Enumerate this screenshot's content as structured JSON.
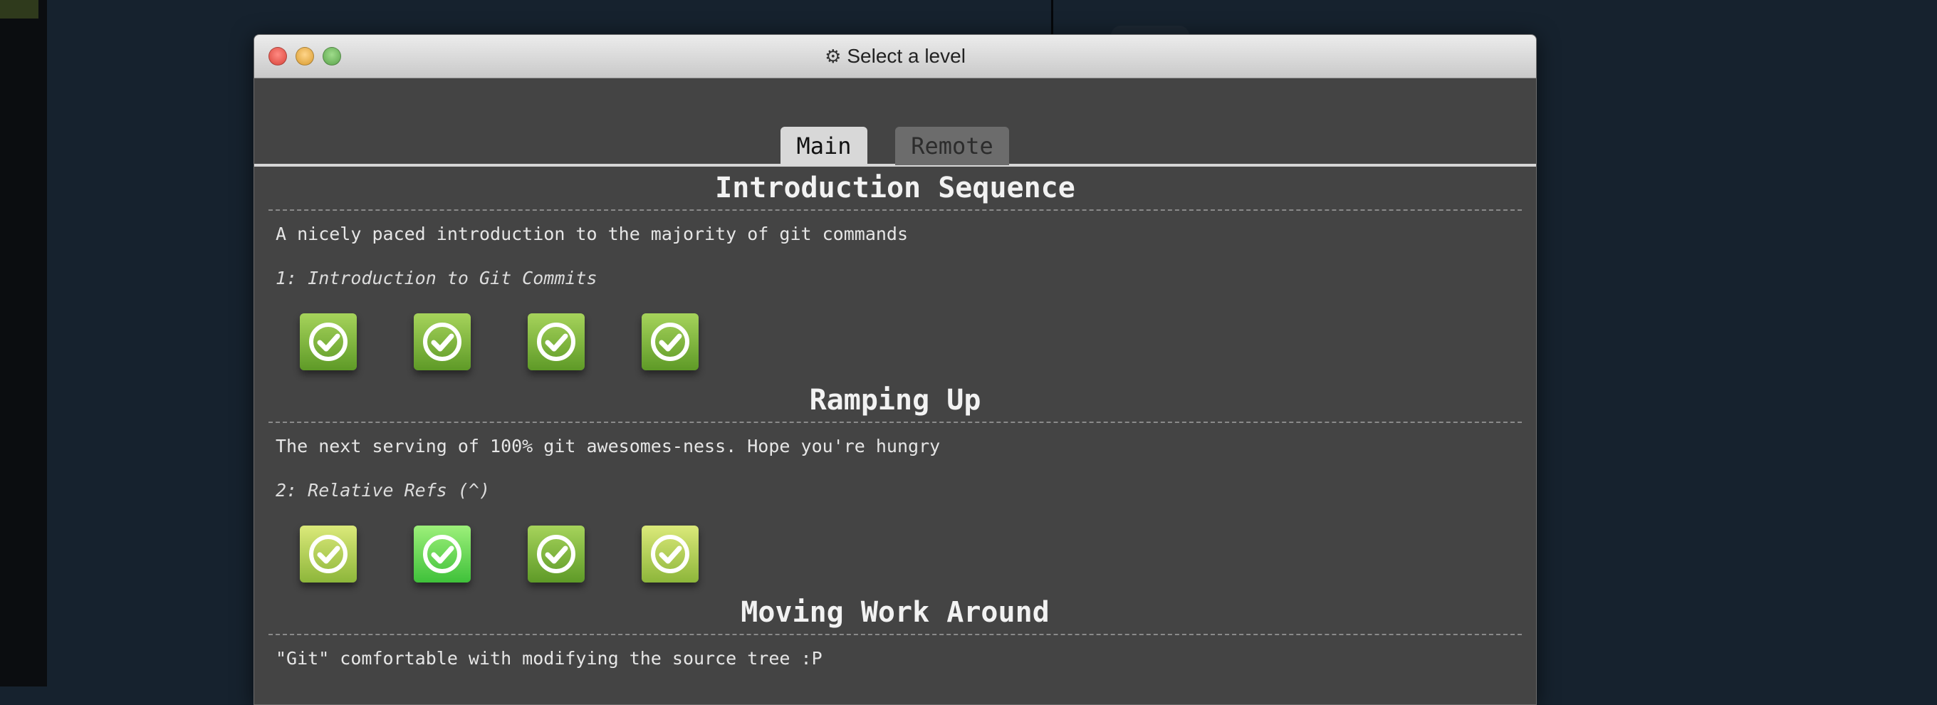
{
  "window": {
    "title": "Select a level",
    "title_icon": "gear-icon"
  },
  "tabs": [
    {
      "label": "Main",
      "active": true
    },
    {
      "label": "Remote",
      "active": false
    }
  ],
  "sequences": [
    {
      "title": "Introduction Sequence",
      "about": "A nicely paced introduction to the majority of git commands",
      "level_name": "1: Introduction to Git Commits",
      "levels": [
        {
          "status": "solved",
          "color": "#7bb73a"
        },
        {
          "status": "solved",
          "color": "#7bb73a"
        },
        {
          "status": "solved",
          "color": "#7bb73a"
        },
        {
          "status": "solved",
          "color": "#7bb73a"
        }
      ]
    },
    {
      "title": "Ramping Up",
      "about": "The next serving of 100% git awesomes-ness. Hope you're hungry",
      "level_name": "2: Relative Refs (^)",
      "levels": [
        {
          "status": "solved",
          "color": "#b5d152"
        },
        {
          "status": "solved-selected",
          "color": "#5fd84a"
        },
        {
          "status": "solved",
          "color": "#7bb73a"
        },
        {
          "status": "solved",
          "color": "#b5d152"
        }
      ]
    },
    {
      "title": "Moving Work Around",
      "about": "\"Git\" comfortable with modifying the source tree :P"
    }
  ]
}
